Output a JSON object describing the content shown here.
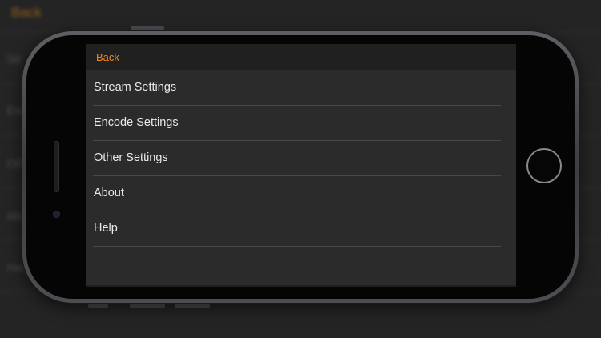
{
  "background_app": {
    "back_label": "Back",
    "rows": [
      "Str",
      "Enc",
      "Oth",
      "Abo",
      "Hel"
    ]
  },
  "nav": {
    "back_label": "Back"
  },
  "menu": {
    "items": [
      {
        "label": "Stream Settings"
      },
      {
        "label": "Encode Settings"
      },
      {
        "label": "Other Settings"
      },
      {
        "label": "About"
      },
      {
        "label": "Help"
      }
    ]
  },
  "colors": {
    "accent": "#f08a1c",
    "background": "#2b2b2b",
    "text": "#eaeaea",
    "separator": "#474747"
  }
}
